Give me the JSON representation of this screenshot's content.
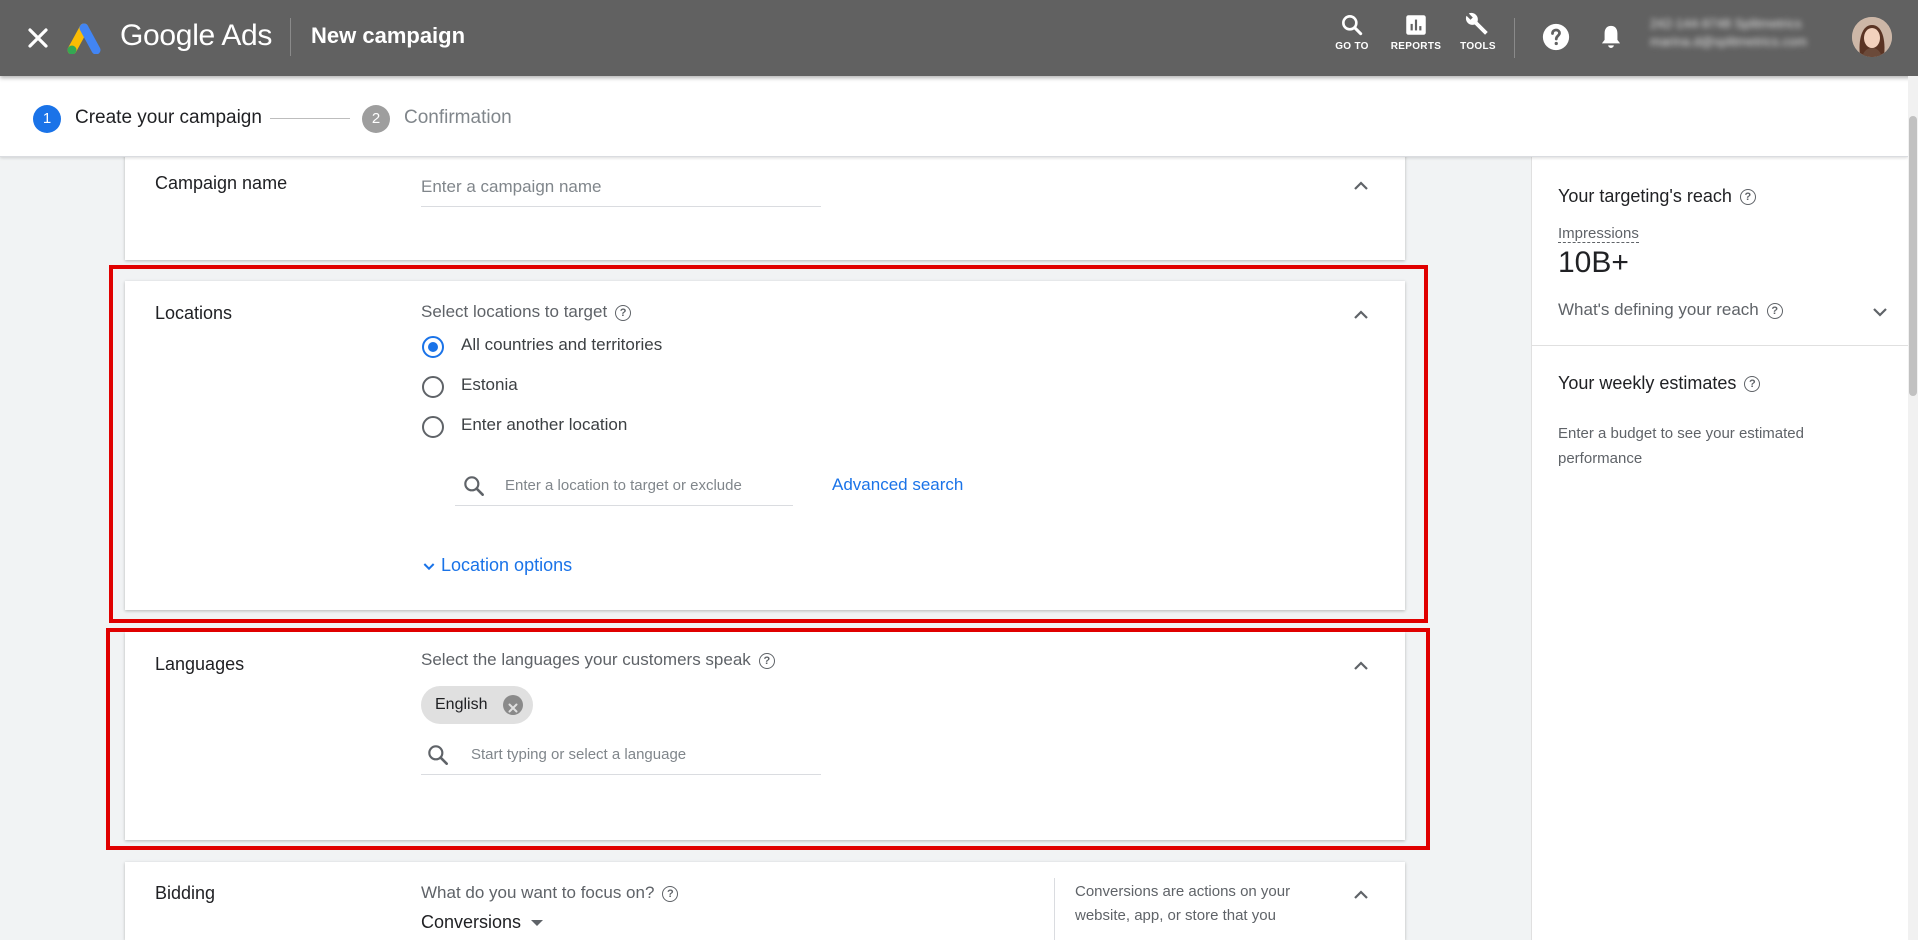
{
  "header": {
    "brand": "Google Ads",
    "page_title": "New campaign",
    "tools": [
      {
        "label": "GO TO"
      },
      {
        "label": "REPORTS"
      },
      {
        "label": "TOOLS"
      }
    ],
    "account": {
      "line1": "242-144-9748 Splitmetrics",
      "line2": "marina.d@splitmetrics.com"
    }
  },
  "stepper": {
    "steps": [
      {
        "number": "1",
        "label": "Create your campaign",
        "active": true
      },
      {
        "number": "2",
        "label": "Confirmation",
        "active": false
      }
    ]
  },
  "campaign_name": {
    "title": "Campaign name",
    "placeholder": "Enter a campaign name"
  },
  "locations": {
    "title": "Locations",
    "subtitle": "Select locations to target",
    "options": [
      {
        "label": "All countries and territories",
        "selected": true
      },
      {
        "label": "Estonia",
        "selected": false
      },
      {
        "label": "Enter another location",
        "selected": false
      }
    ],
    "search_placeholder": "Enter a location to target or exclude",
    "advanced_search": "Advanced search",
    "location_options": "Location options"
  },
  "languages": {
    "title": "Languages",
    "subtitle": "Select the languages your customers speak",
    "chip": "English",
    "search_placeholder": "Start typing or select a language"
  },
  "bidding": {
    "title": "Bidding",
    "subtitle": "What do you want to focus on?",
    "value": "Conversions",
    "help_text": "Conversions are actions on your website, app, or store that you"
  },
  "right_panel": {
    "reach_title": "Your targeting's reach",
    "impressions_label": "Impressions",
    "impressions_value": "10B+",
    "defining_reach": "What's defining your reach",
    "weekly_title": "Your weekly estimates",
    "weekly_text": "Enter a budget to see your estimated performance"
  },
  "colors": {
    "appbar": "#616161",
    "accent": "#1a73e8",
    "highlight": "#e00000"
  }
}
